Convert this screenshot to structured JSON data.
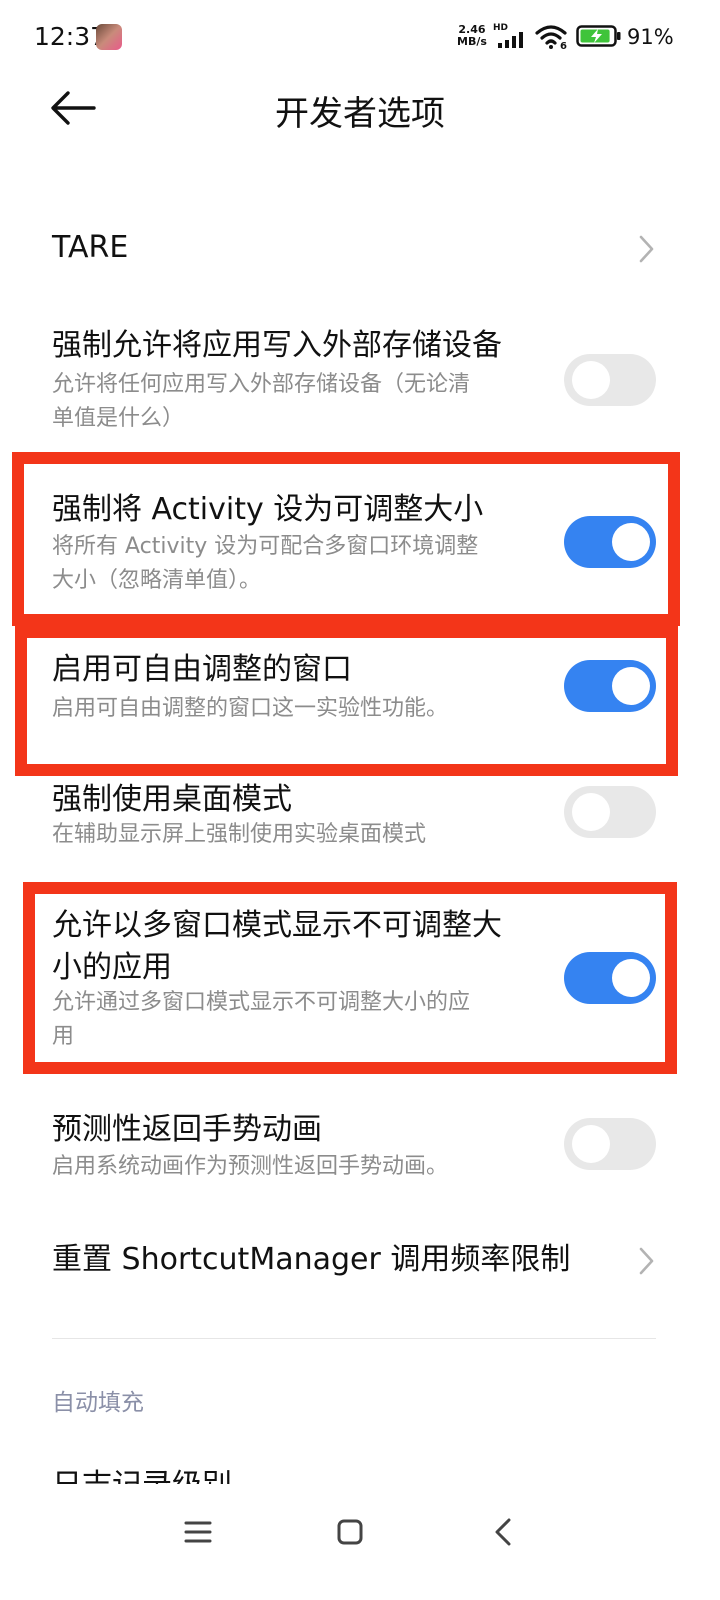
{
  "status_bar": {
    "time": "12:37",
    "net_speed_value": "2.46",
    "net_speed_unit": "MB/s",
    "hd": "HD",
    "wifi_badge": "6",
    "battery_percent": "91%",
    "battery_level": 0.91,
    "battery_charging": true,
    "icons": [
      "app-avatar-icon",
      "signal-icon",
      "wifi-icon",
      "battery-icon"
    ]
  },
  "header": {
    "title": "开发者选项",
    "back_icon": "arrow-left-icon"
  },
  "settings": [
    {
      "title": "TARE",
      "type": "link"
    },
    {
      "title": "强制允许将应用写入外部存储设备",
      "subtitle_line1": "允许将任何应用写入外部存储设备（无论清",
      "subtitle_line2": "单值是什么）",
      "type": "toggle",
      "enabled": false
    },
    {
      "title": "强制将 Activity 设为可调整大小",
      "subtitle_line1": "将所有 Activity 设为可配合多窗口环境调整",
      "subtitle_line2": "大小（忽略清单值）。",
      "type": "toggle",
      "enabled": true,
      "highlighted": true
    },
    {
      "title": "启用可自由调整的窗口",
      "subtitle_line1": "启用可自由调整的窗口这一实验性功能。",
      "type": "toggle",
      "enabled": true,
      "highlighted": true
    },
    {
      "title": "强制使用桌面模式",
      "subtitle_line1": "在辅助显示屏上强制使用实验桌面模式",
      "type": "toggle",
      "enabled": false
    },
    {
      "title_line1": "允许以多窗口模式显示不可调整大",
      "title_line2": "小的应用",
      "subtitle_line1": "允许通过多窗口模式显示不可调整大小的应",
      "subtitle_line2": "用",
      "type": "toggle",
      "enabled": true,
      "highlighted": true
    },
    {
      "title": "预测性返回手势动画",
      "subtitle_line1": "启用系统动画作为预测性返回手势动画。",
      "type": "toggle",
      "enabled": false
    },
    {
      "title": "重置 ShortcutManager 调用频率限制",
      "type": "link"
    }
  ],
  "section": {
    "label": "自动填充"
  },
  "partial_item": {
    "title": "日志记录级别"
  },
  "colors": {
    "accent": "#3583f1",
    "highlight": "#f33519",
    "toggle_off": "#e8e8e8",
    "subtitle": "#8c8c8c",
    "section_label": "#8b90a8"
  },
  "nav_bar": {
    "icons": [
      "menu-icon",
      "home-icon",
      "back-icon"
    ]
  }
}
